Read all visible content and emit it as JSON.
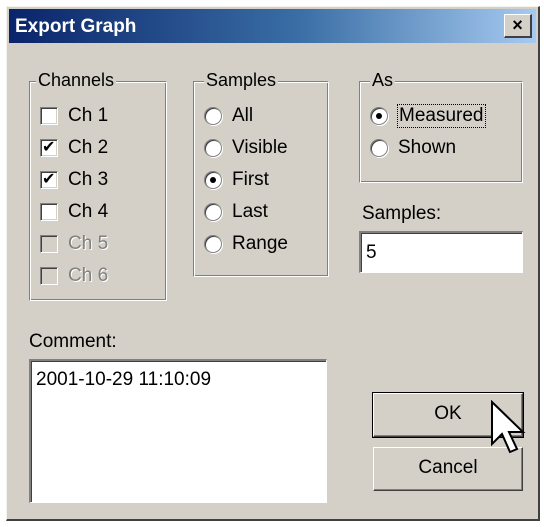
{
  "window": {
    "title": "Export Graph",
    "close_glyph": "×"
  },
  "channels": {
    "label": "Channels",
    "items": [
      {
        "label": "Ch 1",
        "checked": false,
        "enabled": true
      },
      {
        "label": "Ch 2",
        "checked": true,
        "enabled": true
      },
      {
        "label": "Ch 3",
        "checked": true,
        "enabled": true
      },
      {
        "label": "Ch 4",
        "checked": false,
        "enabled": true
      },
      {
        "label": "Ch 5",
        "checked": false,
        "enabled": false
      },
      {
        "label": "Ch 6",
        "checked": false,
        "enabled": false
      }
    ]
  },
  "samples_group": {
    "label": "Samples",
    "options": [
      "All",
      "Visible",
      "First",
      "Last",
      "Range"
    ],
    "selected": "First"
  },
  "as_group": {
    "label": "As",
    "options": [
      "Measured",
      "Shown"
    ],
    "selected": "Measured"
  },
  "samples_field": {
    "label": "Samples:",
    "value": "5"
  },
  "comment": {
    "label": "Comment:",
    "value": "2001-10-29 11:10:09"
  },
  "buttons": {
    "ok": "OK",
    "cancel": "Cancel"
  },
  "colors": {
    "dialog_bg": "#d4d0c8",
    "title_start": "#0a246a",
    "title_end": "#a6caf0",
    "disabled_text": "#808080"
  }
}
